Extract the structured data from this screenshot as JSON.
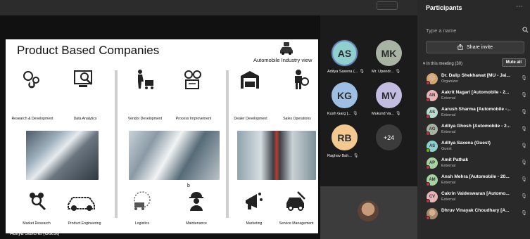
{
  "slide": {
    "title": "Product Based Companies",
    "automobile_label": "Automobile Industry view",
    "sections": [
      {
        "labels": [
          "Research & Development",
          "Data Analytics"
        ],
        "bottom_labels": [
          "Market Research",
          "Product Engineering"
        ]
      },
      {
        "labels": [
          "Vendor Development",
          "Process Improvement"
        ],
        "bottom_labels": [
          "Logistics",
          "Maintenance"
        ]
      },
      {
        "labels": [
          "Dealer Development",
          "Sales Operations"
        ],
        "bottom_labels": [
          "Marketing",
          "Service Management"
        ]
      }
    ],
    "stray_mark": "b"
  },
  "presenter_name": "Aditya Saxena (Guest)",
  "gallery": {
    "tiles": [
      {
        "initials": "AS",
        "name": "Aditya Saxena (...",
        "color": "#8fd0cf",
        "ring": true
      },
      {
        "initials": "MK",
        "name": "Mr. Upendr...",
        "color": "#a9b3a3"
      },
      {
        "initials": "KG",
        "name": "Kush Garg [...",
        "color": "#9dbfe3"
      },
      {
        "initials": "MV",
        "name": "Mukund Va...",
        "color": "#c2bde0"
      },
      {
        "initials": "RB",
        "name": "Raghav Bah...",
        "color": "#f3c98f"
      }
    ],
    "more": "+24"
  },
  "panel": {
    "title": "Participants",
    "search_placeholder": "Type a name",
    "share_invite": "Share invite",
    "in_meeting": "In this meeting (30)",
    "mute_all": "Mute all",
    "participants": [
      {
        "initials": "",
        "name": "Dr. Dalip Shekhawat [MU - Jai...",
        "role": "Organizer",
        "color": "#d4a574",
        "status": "#c4314b",
        "photo": true
      },
      {
        "initials": "AN",
        "name": "Aakrit Nagari [Automobile - 2...",
        "role": "External",
        "color": "#e8b4b8",
        "status": "#c4314b"
      },
      {
        "initials": "AS",
        "name": "Aarush Sharma [Automobile -...",
        "role": "External",
        "color": "#b8dccf",
        "status": "#c4314b"
      },
      {
        "initials": "AG",
        "name": "Aditya Ghosh [Automobile - 2...",
        "role": "External",
        "color": "#a9b3a3",
        "status": "#c4314b"
      },
      {
        "initials": "AS",
        "name": "Aditya Saxena (Guest)",
        "role": "Guest",
        "color": "#8fd0cf",
        "status": "#6bb700"
      },
      {
        "initials": "AP",
        "name": "Amit Pathak",
        "role": "External",
        "color": "#a6d3a0",
        "status": "#c4314b"
      },
      {
        "initials": "AM",
        "name": "Ansh Mehra [Automobile - 20...",
        "role": "External",
        "color": "#a6d3a0",
        "status": "#c4314b"
      },
      {
        "initials": "CV",
        "name": "Cakrin Vaideswaran [Automo...",
        "role": "External",
        "color": "#e8b4b8",
        "status": "#c4314b"
      },
      {
        "initials": "",
        "name": "Dhruv Vinayak Choudhary [A...",
        "role": "",
        "color": "#a58a6b",
        "status": "#c4314b",
        "photo": true
      }
    ]
  }
}
